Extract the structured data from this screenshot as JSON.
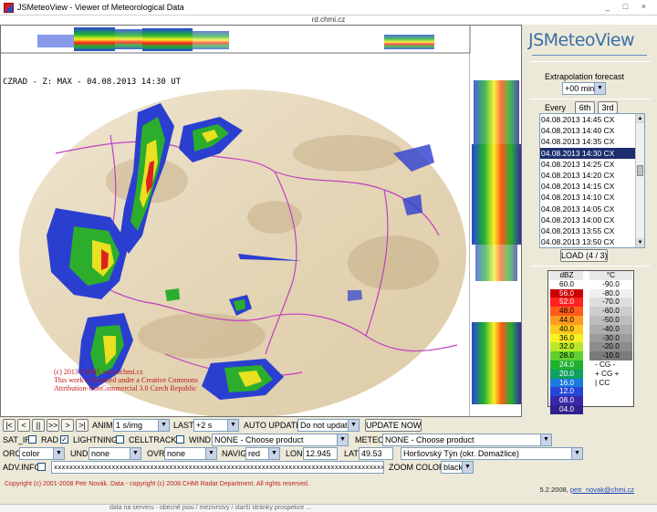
{
  "window": {
    "title": "JSMeteoView - Viewer of Meteorological Data",
    "controls": "_ □ ×",
    "url": "rd.chmi.cz"
  },
  "map": {
    "caption": "CZRAD - Z: MAX - 04.08.2013 14:30 UT",
    "copyright_lines": [
      "(c) 2013 CHMI, www.chmi.cz",
      "This work is licensed under a Creative Commons",
      "Attribution-NonCommercial 3.0 Czech Republic"
    ],
    "colors": {
      "background_disc": "#eadfc8",
      "border_line": "#c040c0",
      "echo_blue": "#2a3fd0",
      "echo_green": "#2cae2c",
      "echo_yellow": "#e8e020",
      "echo_red": "#e02020"
    }
  },
  "panel": {
    "brand": "JSMeteoView",
    "extrapolation_label": "Extrapolation forecast",
    "extrapolation_value": "+00 min",
    "every_label": "Every",
    "every_6th": "6th",
    "every_3rd": "3rd",
    "times": [
      "04.08.2013 14:45 CX",
      "04.08.2013 14:40 CX",
      "04.08.2013 14:35 CX",
      "04.08.2013 14:30 CX",
      "04.08.2013 14:25 CX",
      "04.08.2013 14:20 CX",
      "04.08.2013 14:15 CX",
      "04.08.2013 14:10 CX",
      "04.08.2013 14:05 CX",
      "04.08.2013 14:00 CX",
      "04.08.2013 13:55 CX",
      "04.08.2013 13:50 CX"
    ],
    "selected_index": 3,
    "load_label": "LOAD (4 / 3)"
  },
  "legend": {
    "left_header": "dBZ",
    "right_header": "°C",
    "dbz": [
      {
        "v": "60.0",
        "c": "#ffffff"
      },
      {
        "v": "56.0",
        "c": "#cc0000"
      },
      {
        "v": "52.0",
        "c": "#ff2020"
      },
      {
        "v": "48.0",
        "c": "#ff5a1a"
      },
      {
        "v": "44.0",
        "c": "#ff9a20"
      },
      {
        "v": "40.0",
        "c": "#ffc81c"
      },
      {
        "v": "36.0",
        "c": "#f8f020"
      },
      {
        "v": "32.0",
        "c": "#b8e828"
      },
      {
        "v": "28.0",
        "c": "#60d030"
      },
      {
        "v": "24.0",
        "c": "#20b030"
      },
      {
        "v": "20.0",
        "c": "#10a060"
      },
      {
        "v": "16.0",
        "c": "#1a7ae0"
      },
      {
        "v": "12.0",
        "c": "#2646d8"
      },
      {
        "v": "08.0",
        "c": "#3828a8"
      },
      {
        "v": "04.0",
        "c": "#30208a"
      }
    ],
    "temps": [
      {
        "v": "-90.0",
        "c": "#ffffff"
      },
      {
        "v": "-80.0",
        "c": "#f0f0f0"
      },
      {
        "v": "-70.0",
        "c": "#dedede"
      },
      {
        "v": "-60.0",
        "c": "#cecece"
      },
      {
        "v": "-50.0",
        "c": "#bdbdbd"
      },
      {
        "v": "-40.0",
        "c": "#adadad"
      },
      {
        "v": "-30.0",
        "c": "#9c9c9c"
      },
      {
        "v": "-20.0",
        "c": "#8c8c8c"
      },
      {
        "v": "-10.0",
        "c": "#7b7b7b"
      }
    ],
    "lightning": [
      "- CG -",
      "+ CG +",
      "| CC"
    ]
  },
  "controls": {
    "nav_buttons": [
      "|<",
      "<",
      "||",
      ">>",
      ">",
      ">|"
    ],
    "anim_label": "ANIM",
    "anim_value": "1 s/img",
    "last_label": "LAST",
    "last_value": "+2 s",
    "autoupdate_label": "AUTO UPDATE",
    "autoupdate_value": "Do not update",
    "update_now": "UPDATE NOW",
    "sat_ir": "SAT_IR",
    "rad": "RAD",
    "lightning": "LIGHTNING",
    "celltrack": "CELLTRACK",
    "wind": "WIND",
    "wind_value": "NONE - Choose product",
    "meteo": "METEO",
    "meteo_value": "NONE - Choose product",
    "oro": "ORO",
    "oro_value": "color",
    "und": "UND",
    "und_value": "none",
    "ovr": "OVR",
    "ovr_value": "none",
    "navig": "NAVIG",
    "navig_value": "red",
    "lon_label": "LON",
    "lon_value": "12.945",
    "lat_label": "LAT",
    "lat_value": "49.53",
    "location_value": "Horšovský Týn (okr. Domažlice)",
    "adv_info": "ADV.INFO",
    "adv_text": "xxxxxxxxxxxxxxxxxxxxxxxxxxxxxxxxxxxxxxxxxxxxxxxxxxxxxxxxxxxxxxxxxxxxxxxxxxxxxxxxxxxxxxxxxxxxxxxxxxxxx",
    "zoom_color": "ZOOM COLOR",
    "zoom_value": "black"
  },
  "footer": {
    "copyright": "Copyright (c) 2001-2008 Petr Novák. Data - copyright (c) 2008 CHMI Radar Department. All rights reserved.",
    "date": "5.2.2008,",
    "email": "petr_novak@chmi.cz",
    "strip": "data na serveru · obecně jsou / mezivrstvy / starší stránky prospekce ..."
  }
}
